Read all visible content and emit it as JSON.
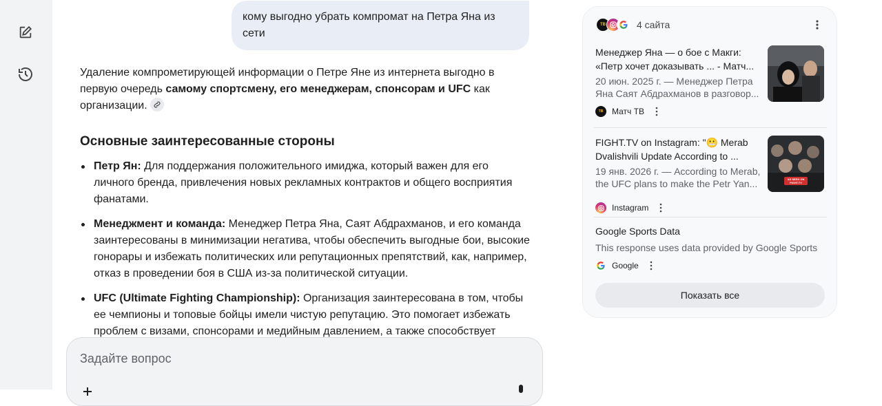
{
  "sidebar": {
    "new_chat_icon": "edit-square-icon",
    "history_icon": "history-icon"
  },
  "conversation": {
    "user_message": "кому выгодно убрать компромат на Петра Яна из сети",
    "answer": {
      "intro_plain_1": "Удаление компрометирующей информации о Петре Яне из интернета выгодно в первую очередь ",
      "intro_bold": "самому спортсмену, его менеджерам, спонсорам и UFC",
      "intro_plain_2": " как организации.",
      "section_heading": "Основные заинтересованные стороны",
      "items": [
        {
          "bold": "Петр Ян:",
          "text": " Для поддержания положительного имиджа, который важен для его личного бренда, привлечения новых рекламных контрактов и общего восприятия фанатами."
        },
        {
          "bold": "Менеджмент и команда:",
          "text": " Менеджер Петра Яна, Саят Абдрахманов, и его команда заинтересованы в минимизации негатива, чтобы обеспечить выгодные бои, высокие гонорары и избежать политических или репутационных препятствий, как, например, отказ в проведении боя в США из-за политической ситуации."
        },
        {
          "bold": "UFC (Ultimate Fighting Championship):",
          "text": " Организация заинтересована в том, чтобы ее чемпионы и топовые бойцы имели чистую репутацию. Это помогает избежать проблем с визами, спонсорами и медийным давлением, а также способствует"
        }
      ]
    }
  },
  "composer": {
    "placeholder": "Задайте вопрос"
  },
  "sources_panel": {
    "count_label": "4 сайта",
    "sources": [
      {
        "title": "Менеджер Яна — о бое с Макги: «Петр хочет доказывать ... - Матч...",
        "snippet": "20 июн. 2025 г. — Менеджер Петра Яна Саят Абдрахманов в разговор...",
        "site": "Матч ТВ",
        "favicon": "match-tv-favicon"
      },
      {
        "title": "FIGHT.TV on Instagram: \"😬 Merab Dvalishvili Update According to ...",
        "snippet": "19 янв. 2026 г. — According to Merab, the UFC plans to make the Petr Yan...",
        "site": "Instagram",
        "favicon": "instagram-favicon",
        "thumb_badge": "AS SEEN ON FIGHT.TV"
      },
      {
        "title": "Google Sports Data",
        "snippet": "This response uses data provided by Google Sports",
        "site": "Google",
        "favicon": "google-favicon"
      }
    ],
    "show_all_label": "Показать все"
  },
  "colors": {
    "sidebar_bg": "#f1f3f4",
    "bubble_bg": "#e9eef6",
    "panel_bg": "#f8f9fa",
    "secondary_text": "#5f6368"
  }
}
